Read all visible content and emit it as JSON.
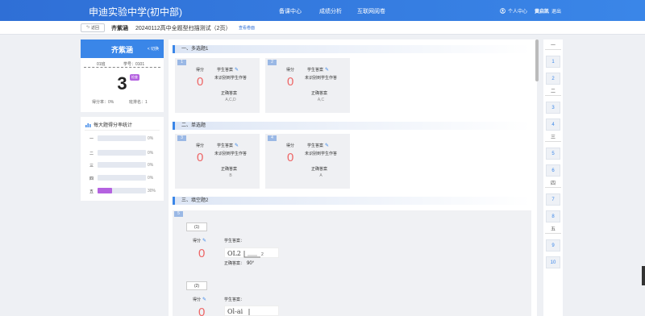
{
  "header": {
    "brand": "申迪实验中学(初中部)",
    "nav": [
      "备课中心",
      "成绩分析",
      "互联网阅卷"
    ],
    "user_center": "个人中心",
    "user_name": "黄启凯",
    "logout": "退出"
  },
  "subbar": {
    "back": "返回",
    "student_name": "齐紫涵",
    "exam_title": "20240112高中全题型扫描测试（2页）",
    "view_paper": "查看卷面"
  },
  "student": {
    "name": "齐紫涵",
    "switch": "< 切换",
    "class": "01班",
    "student_id": "学号：0101",
    "score": "3",
    "badge": "检查",
    "score_rate": "得分率：0%",
    "class_rank": "班排名：1"
  },
  "stats": {
    "title": "每大题得分率统计",
    "rows": [
      {
        "label": "一",
        "pct": "0%",
        "value": 0
      },
      {
        "label": "二",
        "pct": "0%",
        "value": 0
      },
      {
        "label": "三",
        "pct": "0%",
        "value": 0
      },
      {
        "label": "四",
        "pct": "0%",
        "value": 0
      },
      {
        "label": "五",
        "pct": "30%",
        "value": 30
      }
    ]
  },
  "sections": [
    {
      "title": "一、多选题1"
    },
    {
      "title": "二、单选题"
    },
    {
      "title": "三、填空题2"
    }
  ],
  "labels": {
    "score": "得分",
    "student_answer": "学生答案",
    "not_recognized": "未识别到学生作答",
    "correct_answer": "正确答案",
    "student_answer_colon": "学生答案：",
    "correct_answer_colon": "正确答案："
  },
  "questions": [
    {
      "num": "1",
      "score": "0",
      "correct": "A,C,D"
    },
    {
      "num": "2",
      "score": "0",
      "correct": "A,C"
    },
    {
      "num": "3",
      "score": "0",
      "correct": "B"
    },
    {
      "num": "4",
      "score": "0",
      "correct": "A"
    }
  ],
  "fill": {
    "num": "5",
    "subs": [
      {
        "label": "(1)",
        "score": "0",
        "correct": "90°"
      },
      {
        "label": "(2)",
        "score": "0"
      }
    ]
  },
  "sidenav": {
    "sections": [
      "一",
      "二",
      "三",
      "四",
      "五"
    ],
    "numbers": [
      "1",
      "2",
      "3",
      "4",
      "5",
      "6",
      "7",
      "8",
      "9",
      "10"
    ]
  }
}
